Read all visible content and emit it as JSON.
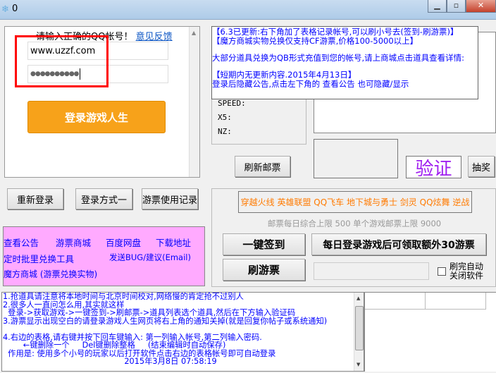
{
  "window": {
    "title": "0",
    "minimize": "▁",
    "maximize": "▫",
    "close": "✕"
  },
  "login": {
    "prompt": "请输入正确的QQ帐号！",
    "feedback_link": "意见反馈",
    "account_value": "www.uzzf.com",
    "password_value": "●●●●●●●●●●",
    "login_button": "登录游戏人生"
  },
  "stats": {
    "speed": "SPEED:",
    "x5": "X5:",
    "nz": "NZ:"
  },
  "notice": {
    "lines": [
      "【6.3已更新:右下角加了表格记录帐号,可以刷小号去(签到-刷游票)】",
      "【魔方商城实物兑换仅支持CF游票,价格100-5000以上】",
      "",
      "大部分道具兑换为QB形式充值到您的帐号,请上商城点击道具查看详情:",
      "",
      "【短期内无更新内容.2015年4月13日】",
      "登录后隐藏公告,点击左下角的 查看公告 也可隐藏/显示"
    ]
  },
  "buttons": {
    "refresh_mail": "刷新邮票",
    "verify": "验证",
    "lottery": "抽奖",
    "relogin": "重新登录",
    "login_mode": "登录方式一",
    "ticket_log": "游票使用记录",
    "one_key_sign": "一键签到",
    "daily_bonus": "每日登录游戏后可领取额外30游票",
    "brush_ticket": "刷游票"
  },
  "links": {
    "view_notice": "查看公告",
    "ticket_mall": "游票商城",
    "baidu_pan": "百度网盘",
    "download": "下载地址",
    "batch_tool": "定时批里兑换工具",
    "send_bug": "发送BUG/建议(Email)",
    "magic_mall": "魔方商城 (游票兑换实物)"
  },
  "games": "穿越火线 英雄联盟 QQ飞车 地下城与勇士 剑灵 QQ炫舞 逆战",
  "limits": "邮票每日综合上限 500 单个游戏邮票上限 9000",
  "auto_close": {
    "label_line1": "刷完自动",
    "label_line2": "关闭软件",
    "checked": false
  },
  "log": {
    "lines": [
      "1.抢道具请注意将本地时间与北京时间校对,网络慢的肯定抢不过别人",
      "2.很多人一直问怎么用,其实就这样",
      "  登录->获取游戏->一键签到->刷邮票->道具列表选个道具,然后在下方输入验证码",
      "3.游票显示出现空白的请登录游戏人生网页将右上角的通知关掉(就是回复你帖子或系统通知)",
      "",
      "4.右边的表格,请右键并按下回车键输入: 第一列输入帐号,第二列输入密码.",
      "        ←键删除一个     Del键删除整格     (结束编辑时自动保存)",
      "  作用是: 使用多个小号的玩家以后打开软件点击右边的表格帐号即可自动登录",
      "                                                2015年3月8日 07:58:19"
    ]
  },
  "colors": {
    "accent_orange": "#f7a21a",
    "pink": "#ffaaff",
    "link_blue": "#0000ff",
    "verify_purple": "#a020f0",
    "highlight_red": "#ff0000"
  }
}
